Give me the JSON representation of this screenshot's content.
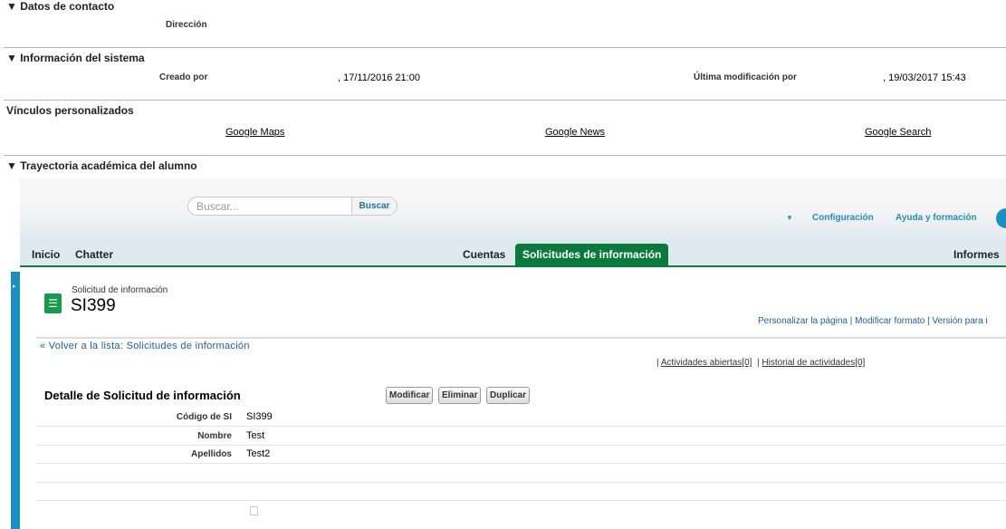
{
  "sections": {
    "contact": {
      "title": "Datos de contacto",
      "address_label": "Dirección"
    },
    "system": {
      "title": "Información del sistema",
      "created_label": "Creado por",
      "created_value": ", 17/11/2016 21:00",
      "modified_label": "Última modificación por",
      "modified_value": ", 19/03/2017 15:43"
    },
    "links": {
      "title": "Vínculos personalizados",
      "items": [
        "Google Maps",
        "Google News",
        "Google Search"
      ]
    },
    "trajectory": {
      "title": "Trayectoria académica del alumno"
    }
  },
  "embedded": {
    "search": {
      "placeholder": "Buscar...",
      "button": "Buscar"
    },
    "top_links": {
      "setup": "Configuración",
      "help": "Ayuda y formación"
    },
    "tabs": [
      "Inicio",
      "Chatter",
      "Cuentas",
      "Solicitudes de información",
      "Informes"
    ],
    "record": {
      "type": "Solicitud de información",
      "name": "SI399"
    },
    "page_links": "Personalizar la página | Modificar formato | Versión para i",
    "back_link": "« Volver a la lista: Solicitudes de información",
    "related": {
      "open_activities": "Actividades abiertas",
      "open_count": "[0]",
      "history": "Historial de actividades",
      "history_count": "[0]"
    },
    "detail": {
      "title": "Detalle de Solicitud de información",
      "buttons": [
        "Modificar",
        "Eliminar",
        "Duplicar"
      ],
      "fields": [
        {
          "label": "Código de SI",
          "value": "SI399"
        },
        {
          "label": "Nombre",
          "value": "Test"
        },
        {
          "label": "Apellidos",
          "value": "Test2"
        }
      ]
    }
  }
}
